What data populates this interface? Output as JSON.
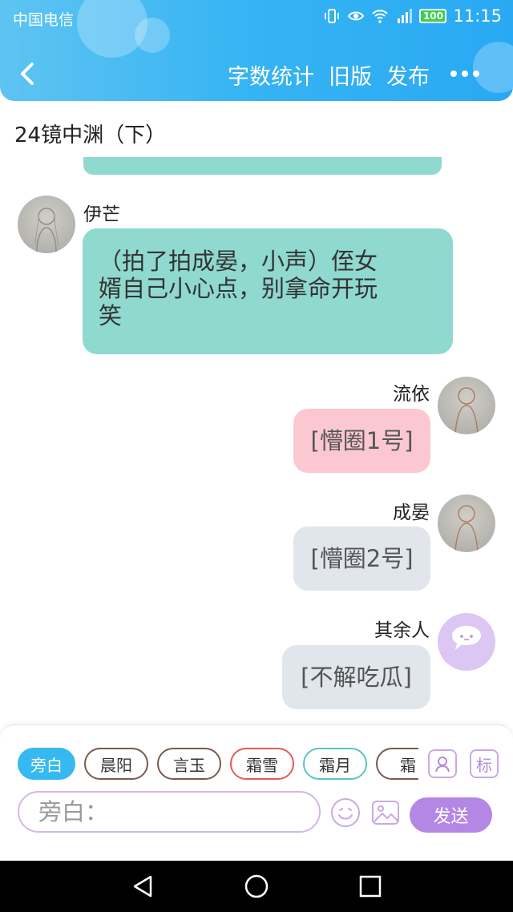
{
  "status_bar": {
    "carrier": "中国电信",
    "battery": "100",
    "time": "11:15"
  },
  "nav": {
    "word_count": "字数统计",
    "old_version": "旧版",
    "publish": "发布"
  },
  "doc_title": "24镜中渊（下）",
  "messages": [
    {
      "side": "left",
      "name": "伊芒",
      "text_lines": [
        "（拍了拍成晏，小声）侄女",
        "婿自己小心点，别拿命开玩",
        "笑"
      ],
      "color": "teal"
    },
    {
      "side": "right",
      "name": "流依",
      "text": "[懵圈1号]",
      "color": "pink"
    },
    {
      "side": "right",
      "name": "成晏",
      "text": "[懵圈2号]",
      "color": "grey"
    },
    {
      "side": "right",
      "name": "其余人",
      "text": "[不解吃瓜]",
      "color": "grey"
    }
  ],
  "role_chips": [
    "旁白",
    "晨阳",
    "言玉",
    "霜雪",
    "霜月",
    "霜"
  ],
  "side_icons": {
    "role_icon": "person-card-icon",
    "tag_label": "标"
  },
  "input": {
    "placeholder": "旁白："
  },
  "send_label": "发送",
  "colors": {
    "header": "#35b3f3",
    "teal_bubble": "#8fd9cf",
    "pink_bubble": "#fbc8d2",
    "grey_bubble": "#e1e5ec",
    "send": "#b487e5"
  }
}
